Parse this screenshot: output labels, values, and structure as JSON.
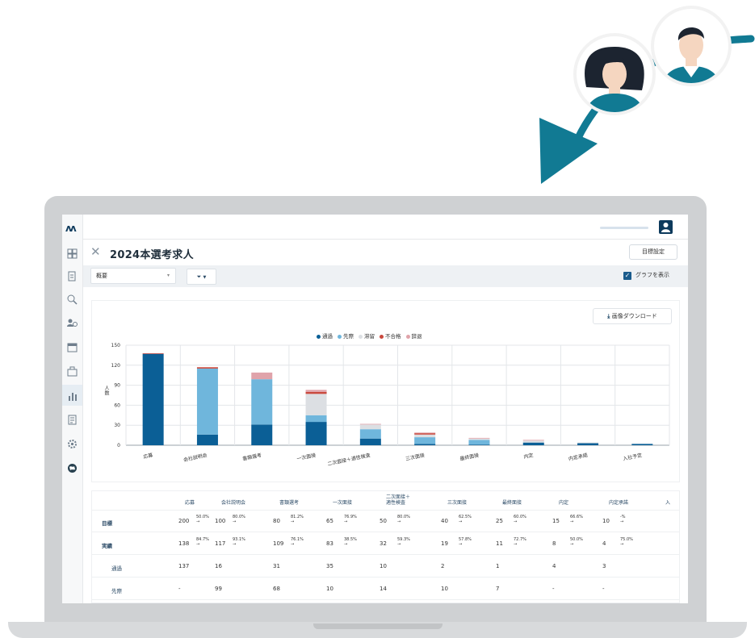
{
  "app": {
    "logo": "M",
    "title": "2024本選考求人",
    "goal_button": "目標設定",
    "view_select": "概要",
    "filter_button": "▼",
    "show_graph_label": "グラフを表示",
    "download_button": "画像ダウンロード"
  },
  "sidebar": {
    "icons": [
      "dashboard-icon",
      "document-icon",
      "search-person-icon",
      "users-icon",
      "calendar-icon",
      "briefcase-icon",
      "bar-chart-icon",
      "form-icon",
      "gear-icon",
      "globe-icon"
    ],
    "active_index": 6
  },
  "colors": {
    "pass": "#0b5f96",
    "ongoing": "#6fb6dc",
    "stagnant": "#dcdfe3",
    "fail": "#c9493e",
    "decline": "#e0a3aa",
    "accent": "#117a93",
    "brand": "#0d3a5c"
  },
  "chart_data": {
    "type": "bar",
    "stacked": true,
    "ylabel": "人数",
    "ylim": [
      0,
      150
    ],
    "yticks": [
      0,
      30,
      60,
      90,
      120,
      150
    ],
    "grid": true,
    "legend_position": "top",
    "categories": [
      "応募",
      "会社説明会",
      "書類選考",
      "一次面接",
      "二次面接＋適性検査",
      "三次面接",
      "最終面接",
      "内定",
      "内定承諾",
      "入社予定"
    ],
    "series": [
      {
        "name": "通過",
        "color": "#0b5f96",
        "values": [
          137,
          16,
          31,
          35,
          10,
          2,
          1,
          4,
          3,
          2
        ]
      },
      {
        "name": "先際",
        "color": "#6fb6dc",
        "values": [
          0,
          99,
          68,
          10,
          14,
          10,
          7,
          0,
          0,
          0
        ]
      },
      {
        "name": "滞留",
        "color": "#dcdfe3",
        "values": [
          0,
          0,
          0,
          32,
          7,
          4,
          2,
          3,
          1,
          0
        ]
      },
      {
        "name": "不合格",
        "color": "#c9493e",
        "values": [
          1,
          2,
          0,
          3,
          0,
          2,
          0,
          0,
          0,
          0
        ]
      },
      {
        "name": "辞退",
        "color": "#e0a3aa",
        "values": [
          0,
          0,
          10,
          3,
          1,
          1,
          1,
          1,
          0,
          0
        ]
      }
    ]
  },
  "table": {
    "headers": [
      "応募",
      "会社説明会",
      "書類選考",
      "一次面接",
      "二次面接＋\n適性検査",
      "三次面接",
      "最終面接",
      "内定",
      "内定承諾",
      "入"
    ],
    "rows": [
      {
        "label": "目標",
        "bold": true,
        "values": [
          "200",
          "100",
          "80",
          "65",
          "50",
          "40",
          "25",
          "15",
          "10"
        ],
        "rates": [
          "50.0%",
          "80.0%",
          "81.2%",
          "76.9%",
          "80.0%",
          "62.5%",
          "60.0%",
          "66.6%",
          "-%"
        ]
      },
      {
        "label": "実績",
        "bold": true,
        "values": [
          "138",
          "117",
          "109",
          "83",
          "32",
          "19",
          "11",
          "8",
          "4"
        ],
        "rates": [
          "84.7%",
          "93.1%",
          "76.1%",
          "38.5%",
          "59.3%",
          "57.8%",
          "72.7%",
          "50.0%",
          "75.0%"
        ]
      },
      {
        "label": "通過",
        "bold": false,
        "values": [
          "137",
          "16",
          "31",
          "35",
          "10",
          "2",
          "1",
          "4",
          "3"
        ],
        "rates": []
      },
      {
        "label": "先際",
        "bold": false,
        "values": [
          "-",
          "99",
          "68",
          "10",
          "14",
          "10",
          "7",
          "-",
          "-"
        ],
        "rates": []
      }
    ]
  }
}
